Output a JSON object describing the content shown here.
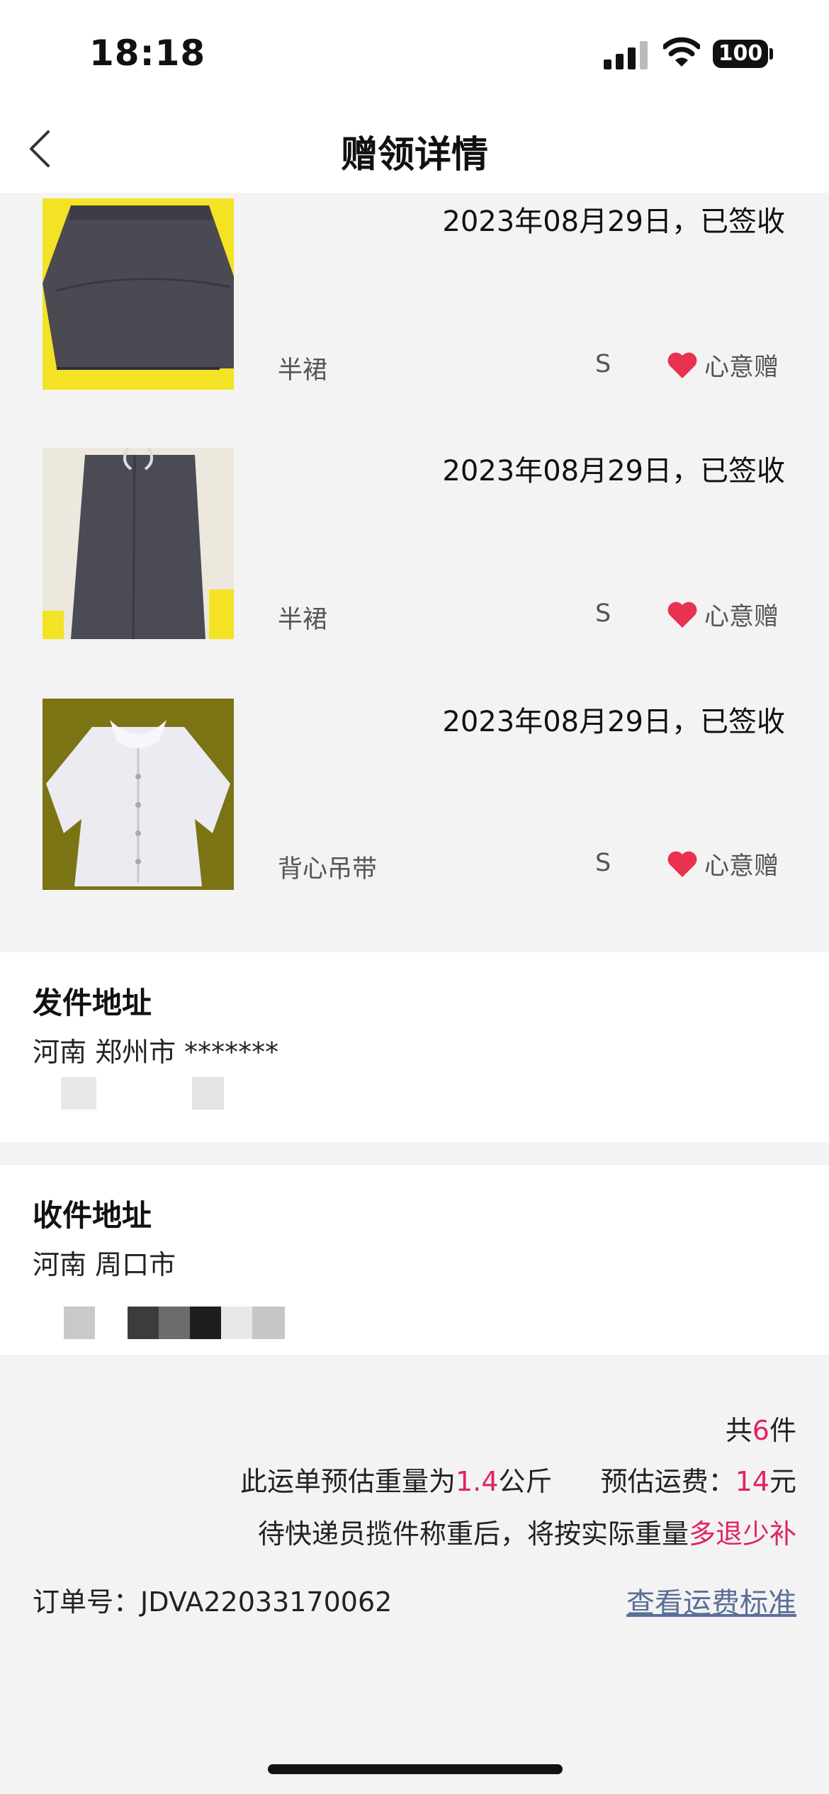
{
  "status_bar": {
    "time": "18:18",
    "battery": "100"
  },
  "nav": {
    "title": "赠领详情"
  },
  "items": [
    {
      "date": "2023年08月29日，已签收",
      "name": "半裙",
      "size": "S",
      "tag": "心意赠"
    },
    {
      "date": "2023年08月29日，已签收",
      "name": "半裙",
      "size": "S",
      "tag": "心意赠"
    },
    {
      "date": "2023年08月29日，已签收",
      "name": "背心吊带",
      "size": "S",
      "tag": "心意赠"
    }
  ],
  "sender": {
    "title": "发件地址",
    "line1": "河南 郑州市 *******"
  },
  "receiver": {
    "title": "收件地址",
    "line1": "河南 周口市"
  },
  "summary": {
    "count_prefix": "共",
    "count_value": "6",
    "count_suffix": "件",
    "weight_prefix": "此运单预估重量为",
    "weight_value": "1.4",
    "weight_unit": "公斤",
    "fee_prefix": "预估运费：",
    "fee_value": "14",
    "fee_unit": "元",
    "note_prefix": "待快递员揽件称重后，将按实际重量",
    "note_highlight": "多退少补"
  },
  "order": {
    "label": "订单号：",
    "number": "JDVA22033170062"
  },
  "fee_link": "查看运费标准",
  "colors": {
    "accent": "#e0245e",
    "link": "#5a6f98"
  }
}
